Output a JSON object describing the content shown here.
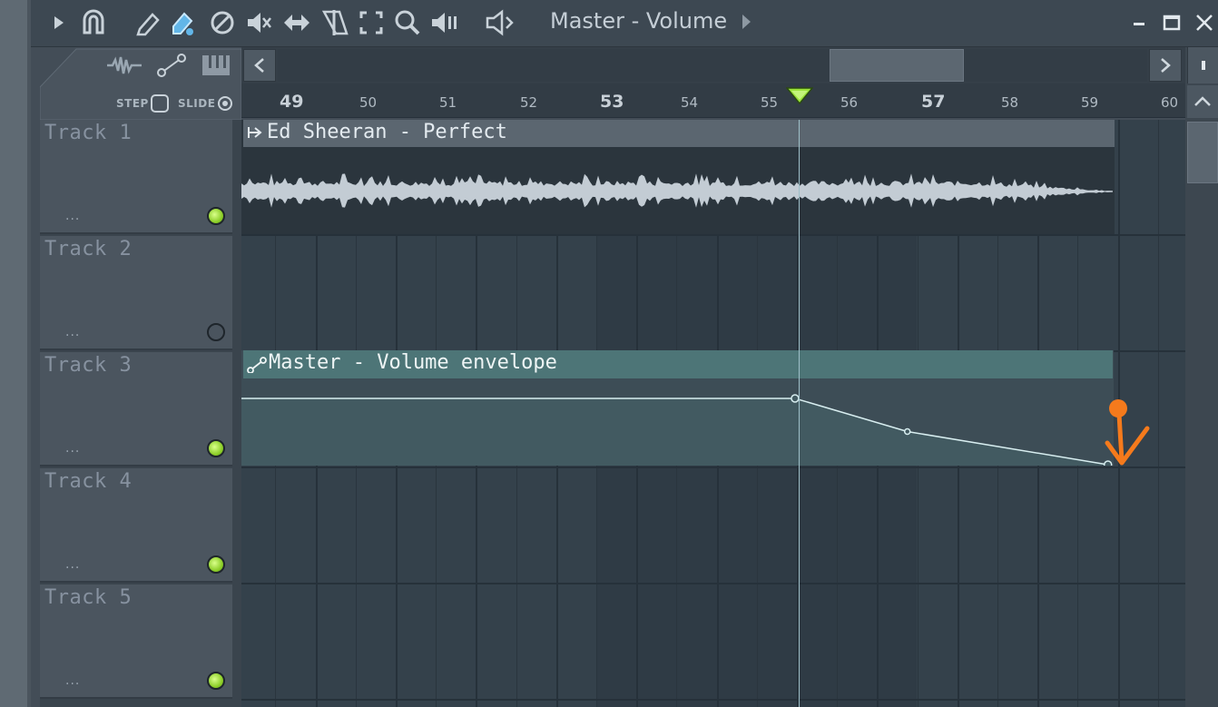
{
  "window": {
    "title": "Master - Volume",
    "title_arrow_icon": "triangle-right-icon"
  },
  "toolbar": {
    "icons": [
      "play-icon",
      "magnet-icon",
      "pencil-icon",
      "paint-brush-icon",
      "delete-icon",
      "mute-icon",
      "slip-icon",
      "slice-icon",
      "select-icon",
      "zoom-icon",
      "playback-icon",
      "speaker-icon"
    ],
    "window_controls": [
      "minimize-icon",
      "maximize-icon",
      "close-icon"
    ]
  },
  "header": {
    "step_label": "STEP",
    "slide_label": "SLIDE",
    "view_icons": [
      "audio-wave-icon",
      "automation-icon",
      "piano-icon"
    ]
  },
  "ruler": {
    "numbers": [
      "49",
      "50",
      "51",
      "52",
      "53",
      "54",
      "55",
      "56",
      "57",
      "58",
      "59",
      "60"
    ],
    "emphasized": [
      "49",
      "53",
      "57"
    ],
    "playhead_bar": 55.4
  },
  "tracks": [
    {
      "name": "Track 1",
      "dots": "...",
      "enabled": true
    },
    {
      "name": "Track 2",
      "dots": "...",
      "enabled": false
    },
    {
      "name": "Track 3",
      "dots": "...",
      "enabled": true
    },
    {
      "name": "Track 4",
      "dots": "...",
      "enabled": true
    },
    {
      "name": "Track 5",
      "dots": "...",
      "enabled": true
    }
  ],
  "clips": {
    "audio": {
      "title": "Ed Sheeran - Perfect",
      "icon": "audio-clip-icon",
      "track": "Track 1"
    },
    "envelope": {
      "title": "Master - Volume envelope",
      "icon": "automation-clip-icon",
      "track": "Track 3"
    }
  },
  "envelope_points": [
    {
      "bar": 49,
      "level": 0.8
    },
    {
      "bar": 55.9,
      "level": 0.8
    },
    {
      "bar": 57.3,
      "level": 0.4
    },
    {
      "bar": 59.8,
      "level": 0.0
    }
  ],
  "colors": {
    "led_on": "#8ecf2a",
    "envelope_clip": "#4d7577",
    "audio_clip": "#5b6670",
    "annotation": "#f57a1c"
  }
}
